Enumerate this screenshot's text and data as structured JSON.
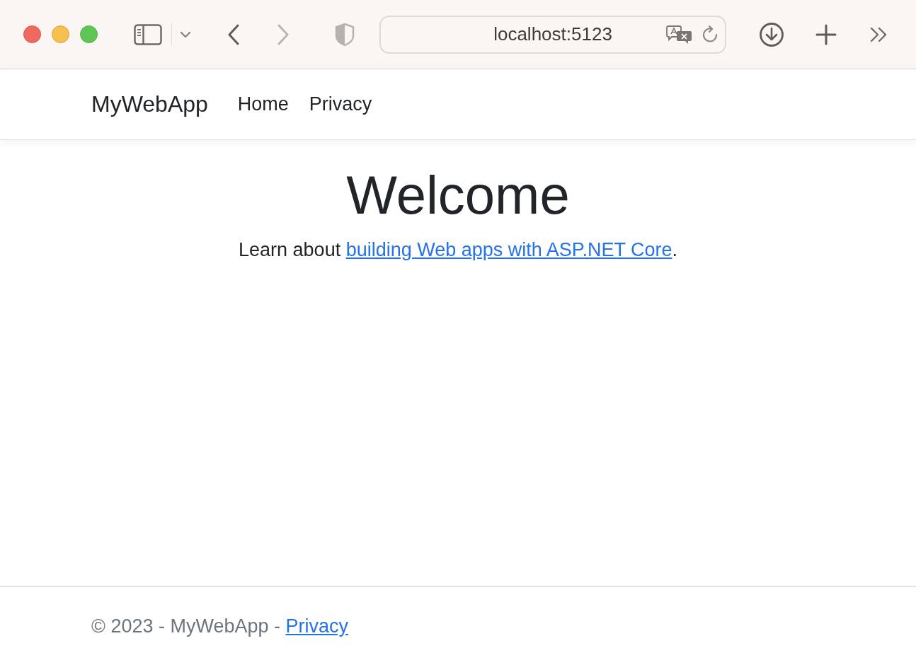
{
  "browser": {
    "nav_buttons": [
      {
        "kind": "back",
        "disabled": false
      },
      {
        "kind": "forward",
        "disabled": true
      }
    ],
    "address": "localhost:5123"
  },
  "navbar": {
    "brand": "MyWebApp",
    "links": [
      "Home",
      "Privacy"
    ]
  },
  "main": {
    "heading": "Welcome",
    "text_before": "Learn about ",
    "link": "building Web apps with ASP.NET Core",
    "text_after": "."
  },
  "footer": {
    "text": "© 2023 - MyWebApp - ",
    "link": "Privacy"
  }
}
